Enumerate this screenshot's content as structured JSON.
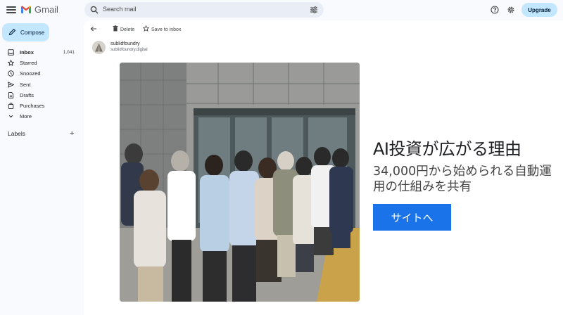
{
  "app": {
    "name": "Gmail"
  },
  "search": {
    "placeholder": "Search mail"
  },
  "header": {
    "upgrade_label": "Upgrade"
  },
  "compose": {
    "label": "Compose"
  },
  "sidebar": {
    "items": [
      {
        "label": "Inbox",
        "count": "1,041",
        "icon": "inbox-icon"
      },
      {
        "label": "Starred",
        "icon": "star-icon"
      },
      {
        "label": "Snoozed",
        "icon": "clock-icon"
      },
      {
        "label": "Sent",
        "icon": "send-icon"
      },
      {
        "label": "Drafts",
        "icon": "draft-icon"
      },
      {
        "label": "Purchases",
        "icon": "bag-icon"
      },
      {
        "label": "More",
        "icon": "chevron-down-icon"
      }
    ],
    "labels_heading": "Labels"
  },
  "toolbar": {
    "delete_label": "Delete",
    "save_label": "Save to inbox"
  },
  "message": {
    "sender_name": "sublidfoundry",
    "sender_email": "sublidfoundry.digital",
    "headline": "AI投資が広がる理由",
    "subline": "34,000円から始められる自動運用の仕組みを共有",
    "cta_label": "サイトへ"
  },
  "colors": {
    "accent": "#1a73e8",
    "compose_bg": "#c2e7ff",
    "search_bg": "#e9eef6"
  }
}
